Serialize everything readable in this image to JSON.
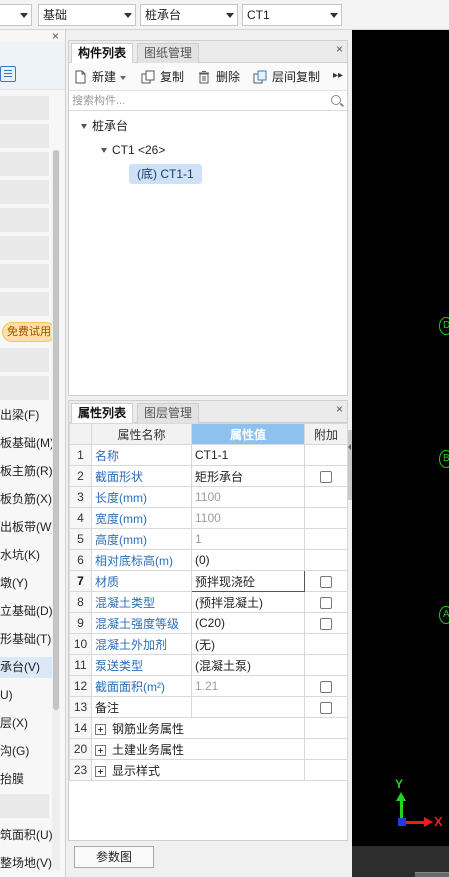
{
  "toolbar": {
    "floor": "",
    "category": "基础",
    "type": "桩承台",
    "component": "CT1"
  },
  "left_panel": {
    "trial_badge": "免费试用",
    "items": [
      {
        "label": "出梁(F)",
        "selected": false
      },
      {
        "label": "板基础(M)",
        "selected": false
      },
      {
        "label": "板主筋(R)",
        "selected": false
      },
      {
        "label": "板负筋(X)",
        "selected": false
      },
      {
        "label": "出板带(W)",
        "selected": false
      },
      {
        "label": "水坑(K)",
        "selected": false
      },
      {
        "label": "墩(Y)",
        "selected": false
      },
      {
        "label": "立基础(D)",
        "selected": false
      },
      {
        "label": "形基础(T)",
        "selected": false
      },
      {
        "label": "承台(V)",
        "selected": true
      },
      {
        "label": "U)",
        "selected": false
      },
      {
        "label": "层(X)",
        "selected": false
      },
      {
        "label": "沟(G)",
        "selected": false
      },
      {
        "label": "抬膜",
        "selected": false
      },
      {
        "label": "筑面积(U)",
        "selected": false
      },
      {
        "label": "整场地(V)",
        "selected": false
      }
    ]
  },
  "component_panel": {
    "tabs": [
      "构件列表",
      "图纸管理"
    ],
    "buttons": {
      "new": "新建",
      "copy": "复制",
      "delete": "删除",
      "floor_copy": "层间复制"
    },
    "search_placeholder": "搜索构件...",
    "tree": {
      "root": "桩承台",
      "child": "CT1 <26>",
      "leaf": "(底) CT1-1"
    }
  },
  "property_panel": {
    "tabs": [
      "属性列表",
      "图层管理"
    ],
    "headers": {
      "name": "属性名称",
      "value": "属性值",
      "extra": "附加"
    },
    "rows": [
      {
        "no": "1",
        "name": "名称",
        "value": "CT1-1",
        "checkbox": false,
        "name_style": "link",
        "value_style": "normal"
      },
      {
        "no": "2",
        "name": "截面形状",
        "value": "矩形承台",
        "checkbox": true,
        "name_style": "link",
        "value_style": "normal"
      },
      {
        "no": "3",
        "name": "长度(mm)",
        "value": "1100",
        "checkbox": false,
        "name_style": "link",
        "value_style": "grey"
      },
      {
        "no": "4",
        "name": "宽度(mm)",
        "value": "1100",
        "checkbox": false,
        "name_style": "link",
        "value_style": "grey"
      },
      {
        "no": "5",
        "name": "高度(mm)",
        "value": "1",
        "checkbox": false,
        "name_style": "link",
        "value_style": "grey"
      },
      {
        "no": "6",
        "name": "相对底标高(m)",
        "value": "(0)",
        "checkbox": false,
        "name_style": "link",
        "value_style": "normal"
      },
      {
        "no": "7",
        "name": "材质",
        "value": "预拌现浇砼",
        "checkbox": true,
        "name_style": "link",
        "value_style": "edit"
      },
      {
        "no": "8",
        "name": "混凝土类型",
        "value": "(预拌混凝土)",
        "checkbox": true,
        "name_style": "link",
        "value_style": "normal"
      },
      {
        "no": "9",
        "name": "混凝土强度等级",
        "value": "(C20)",
        "checkbox": true,
        "name_style": "link",
        "value_style": "normal"
      },
      {
        "no": "10",
        "name": "混凝土外加剂",
        "value": "(无)",
        "checkbox": false,
        "name_style": "link",
        "value_style": "normal"
      },
      {
        "no": "11",
        "name": "泵送类型",
        "value": "(混凝土泵)",
        "checkbox": false,
        "name_style": "link",
        "value_style": "normal"
      },
      {
        "no": "12",
        "name": "截面面积(m²)",
        "value": "1.21",
        "checkbox": true,
        "name_style": "link",
        "value_style": "grey"
      },
      {
        "no": "13",
        "name": "备注",
        "value": "",
        "checkbox": true,
        "name_style": "dark",
        "value_style": "normal"
      }
    ],
    "groups": [
      {
        "no": "14",
        "label": "钢筋业务属性"
      },
      {
        "no": "20",
        "label": "土建业务属性"
      },
      {
        "no": "23",
        "label": "显示样式"
      }
    ],
    "param_button": "参数图"
  },
  "viewport": {
    "axis_labels": [
      "D",
      "B",
      "A"
    ],
    "ucs": {
      "x": "X",
      "y": "Y"
    },
    "colors": {
      "axis": "#26c426",
      "x": "#e51e1e",
      "y": "#23d223",
      "origin": "#1e3ce5"
    }
  }
}
